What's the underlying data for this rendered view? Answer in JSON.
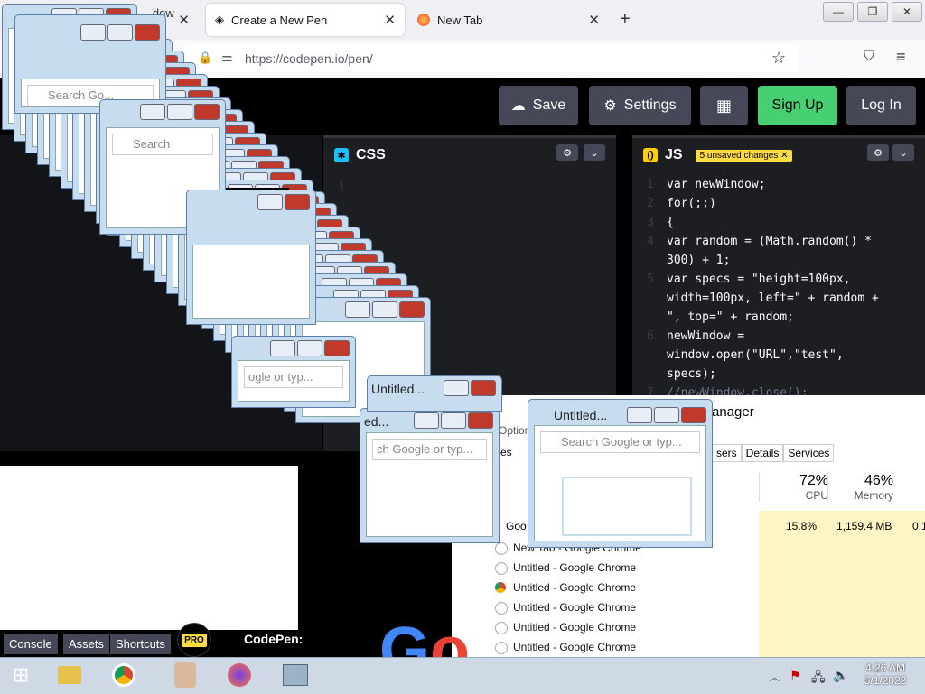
{
  "browser": {
    "tabs": [
      {
        "label": "...dow n"
      },
      {
        "label": "Create a New Pen"
      },
      {
        "label": "New Tab"
      }
    ],
    "url": "https://codepen.io/pen/"
  },
  "codepen": {
    "buttons": {
      "save": "Save",
      "settings": "Settings",
      "signup": "Sign Up",
      "login": "Log In"
    },
    "css_title": "CSS",
    "js_title": "JS",
    "unsaved_badge": "5 unsaved changes",
    "css_lines": [
      "1"
    ],
    "js_code": [
      {
        "n": "1",
        "text": "var newWindow;"
      },
      {
        "n": "2",
        "text": "for(;;)"
      },
      {
        "n": "3",
        "text": "{"
      },
      {
        "n": "4",
        "text": "var random = (Math.random() *"
      },
      {
        "n": "",
        "text": "300) + 1;"
      },
      {
        "n": "5",
        "text": "var specs = \"height=100px,"
      },
      {
        "n": "",
        "text": "width=100px, left=\" + random +"
      },
      {
        "n": "",
        "text": "\", top=\" + random;"
      },
      {
        "n": "6",
        "text": "newWindow ="
      },
      {
        "n": "",
        "text": "window.open(\"URL\",\"test\","
      },
      {
        "n": "",
        "text": "specs);"
      },
      {
        "n": "7",
        "text": "//newWindow.close();"
      }
    ],
    "footer": {
      "console": "Console",
      "assets": "Assets",
      "shortcuts": "Shortcuts",
      "pro": "PRO",
      "brand": "CodePen:"
    }
  },
  "popups": {
    "title": "Untitled...",
    "title_short": "ed...",
    "title2": "Untitled...",
    "search": "Search Google or typ...",
    "search2": "Search Go...",
    "search3": "ch Google or typ...",
    "search4": "ogle or typ...",
    "search5": "Search",
    "search6": "Search Google or typ..."
  },
  "task_manager": {
    "title": "anager",
    "tabs": [
      "Options",
      "ses",
      "sers",
      "Details",
      "Services"
    ],
    "cpu_pct": "72%",
    "cpu_label": "CPU",
    "mem_pct": "46%",
    "mem_label": "Memory",
    "row_cpu": "15.8%",
    "row_mem": "1,159.4 MB",
    "row_extra": "0.1",
    "row_google": "Goo",
    "processes": [
      "New Tab - Google Chrome",
      "Untitled - Google Chrome",
      "Untitled - Google Chrome",
      "Untitled - Google Chrome",
      "Untitled - Google Chrome",
      "Untitled - Google Chrome"
    ]
  },
  "taskbar": {
    "time": "4:26 AM",
    "date": "5/1/2022"
  }
}
